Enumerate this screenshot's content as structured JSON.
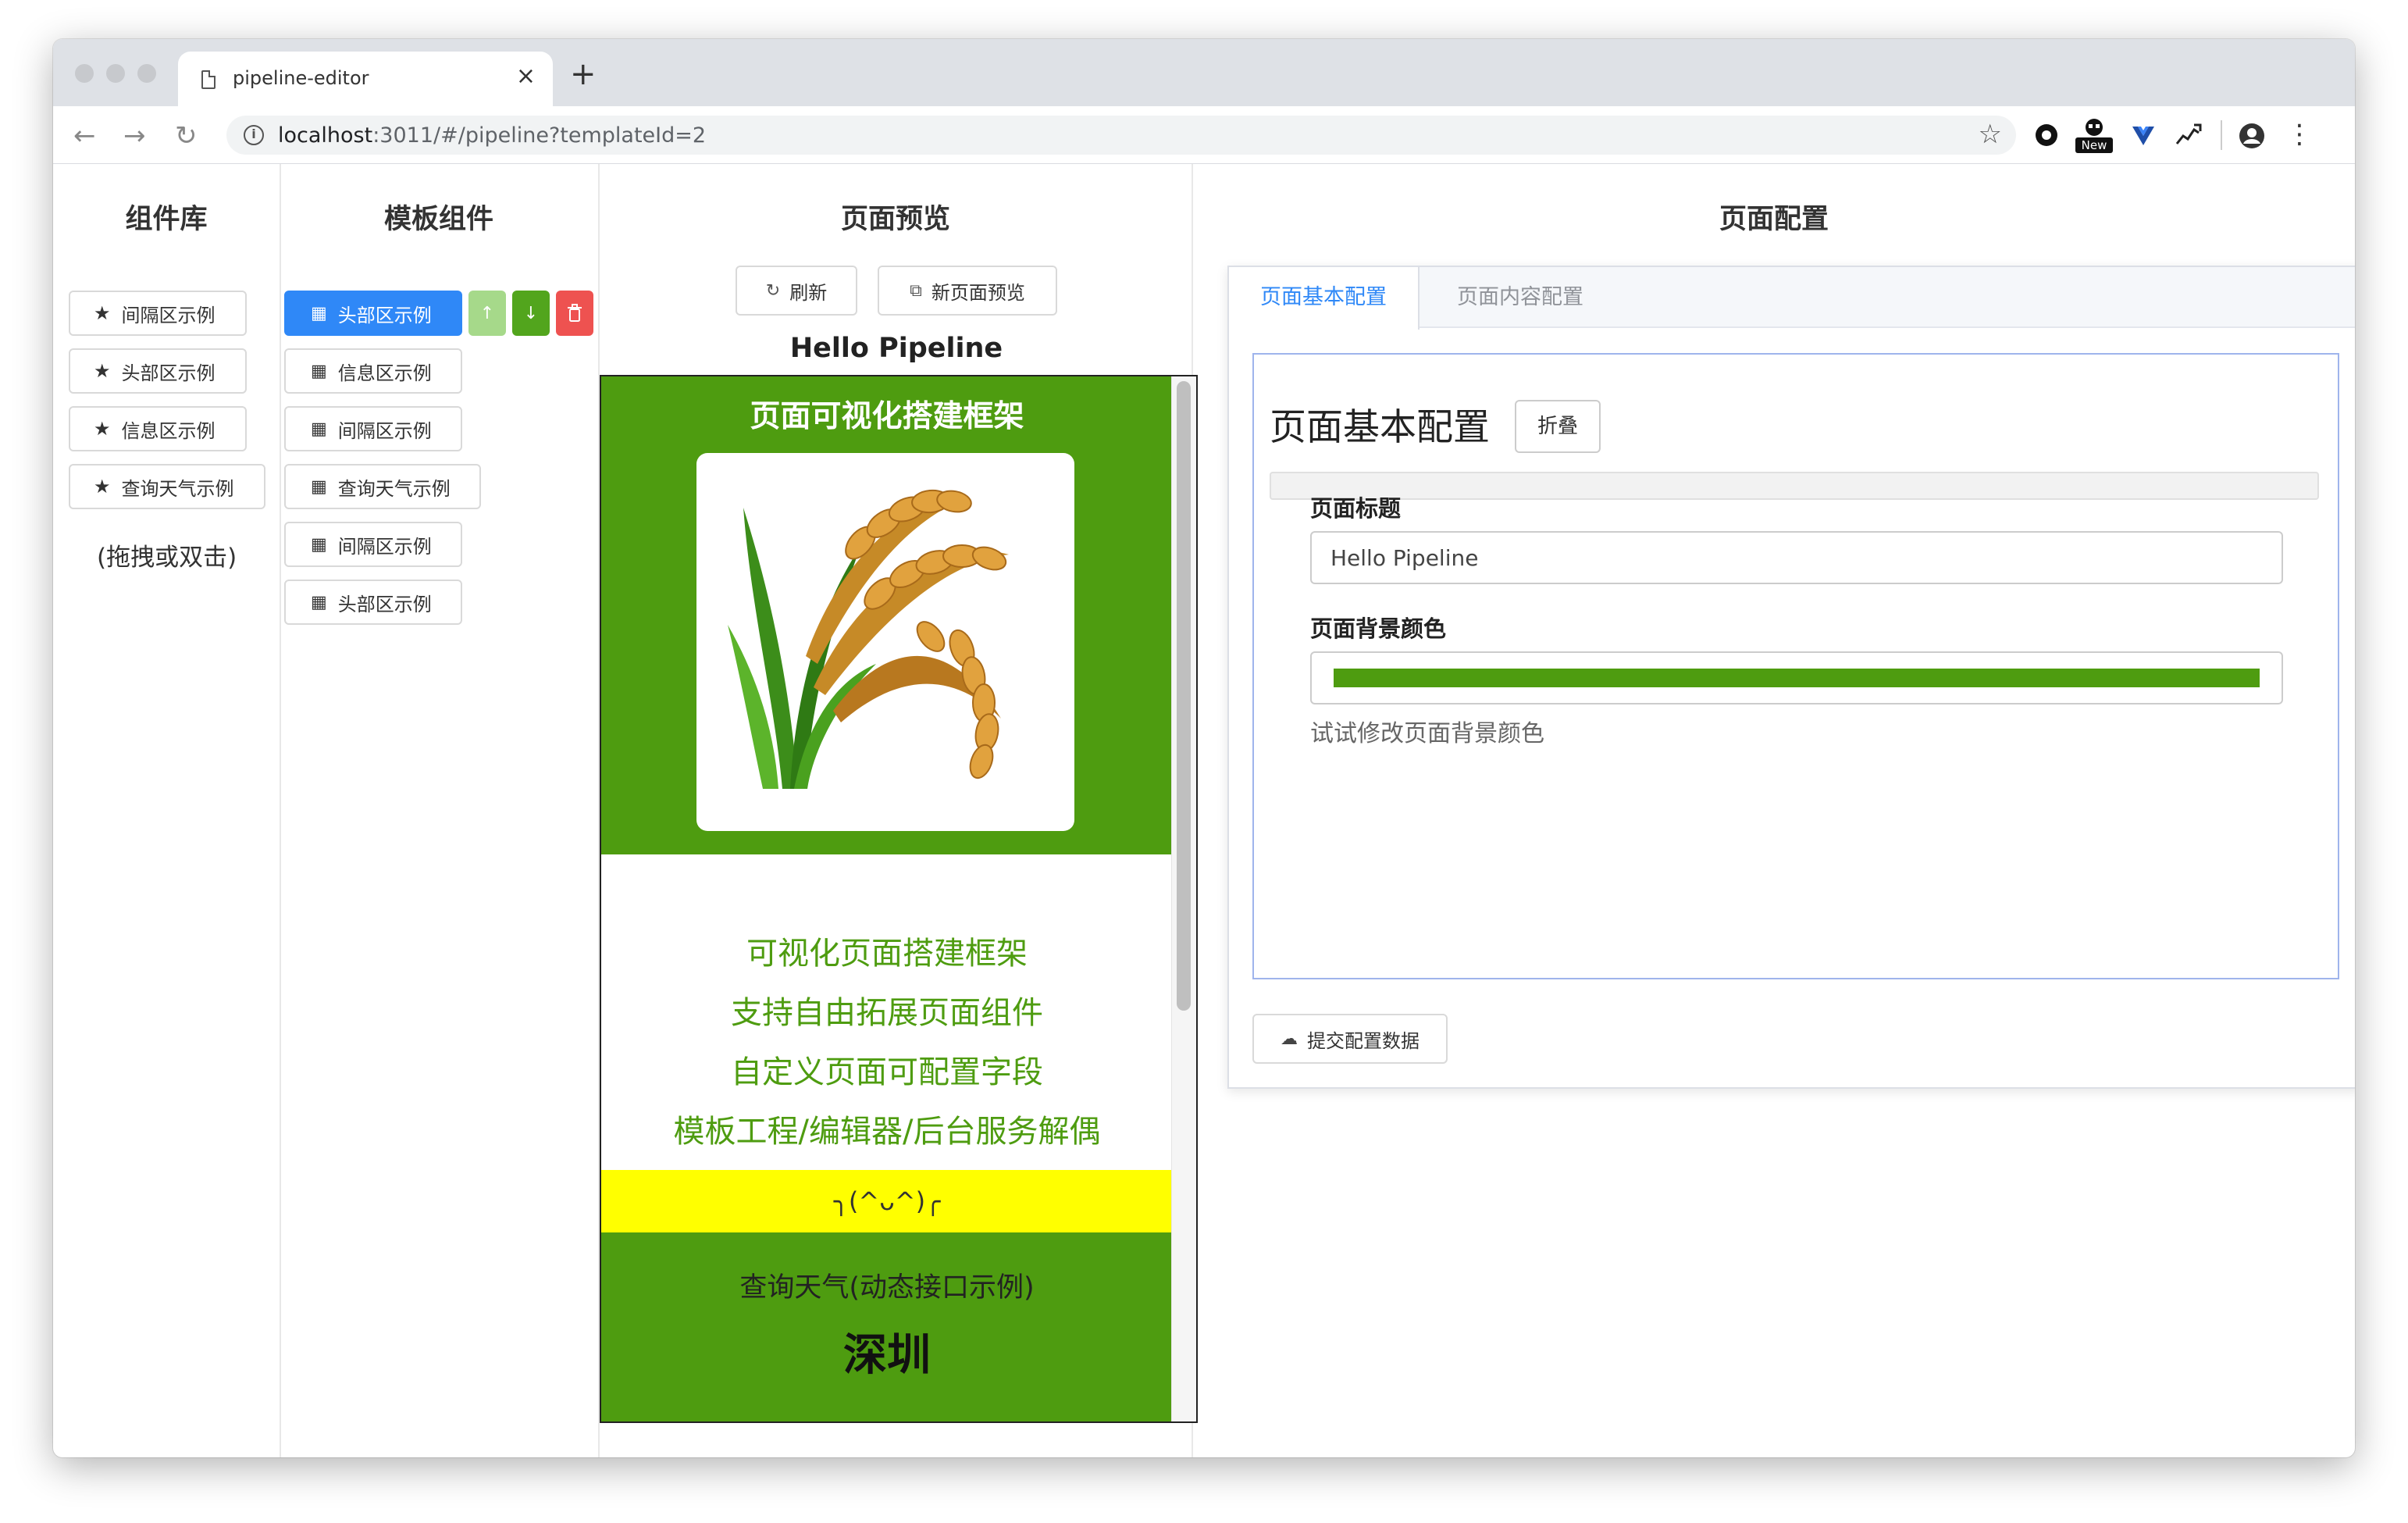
{
  "browser": {
    "tab_title": "pipeline-editor",
    "tab_close": "×",
    "new_tab": "+",
    "url_host": "localhost",
    "url_rest": ":3011/#/pipeline?templateId=2",
    "ext_new_badge": "New"
  },
  "library": {
    "title": "组件库",
    "items": [
      {
        "label": "间隔区示例"
      },
      {
        "label": "头部区示例"
      },
      {
        "label": "信息区示例"
      },
      {
        "label": "查询天气示例"
      }
    ],
    "hint": "(拖拽或双击)"
  },
  "template": {
    "title": "模板组件",
    "items": [
      {
        "label": "头部区示例",
        "active": true
      },
      {
        "label": "信息区示例"
      },
      {
        "label": "间隔区示例"
      },
      {
        "label": "查询天气示例"
      },
      {
        "label": "间隔区示例"
      },
      {
        "label": "头部区示例"
      }
    ],
    "up_label": "↑",
    "down_label": "↓"
  },
  "preview": {
    "title": "页面预览",
    "refresh_label": "刷新",
    "new_page_label": "新页面预览",
    "page_heading": "Hello Pipeline",
    "hero_title": "页面可视化搭建框架",
    "info_lines": [
      "可视化页面搭建框架",
      "支持自由拓展页面组件",
      "自定义页面可配置字段",
      "模板工程/编辑器/后台服务解偶"
    ],
    "kaomoji": "╮(^ᴗ^)╭",
    "weather_title": "查询天气(动态接口示例)",
    "city": "深圳"
  },
  "config": {
    "title": "页面配置",
    "tabs": [
      "页面基本配置",
      "页面内容配置"
    ],
    "form_title": "页面基本配置",
    "collapse_label": "折叠",
    "field_title_label": "页面标题",
    "field_title_value": "Hello Pipeline",
    "field_bg_label": "页面背景颜色",
    "field_bg_help": "试试修改页面背景颜色",
    "submit_label": "提交配置数据"
  },
  "colors": {
    "page_bg": "#4e9c10",
    "accent": "#2f88f7",
    "up_button": "#a6d98a",
    "down_button": "#52a51d",
    "delete_button": "#ee5250",
    "highlight": "#ffff00"
  }
}
